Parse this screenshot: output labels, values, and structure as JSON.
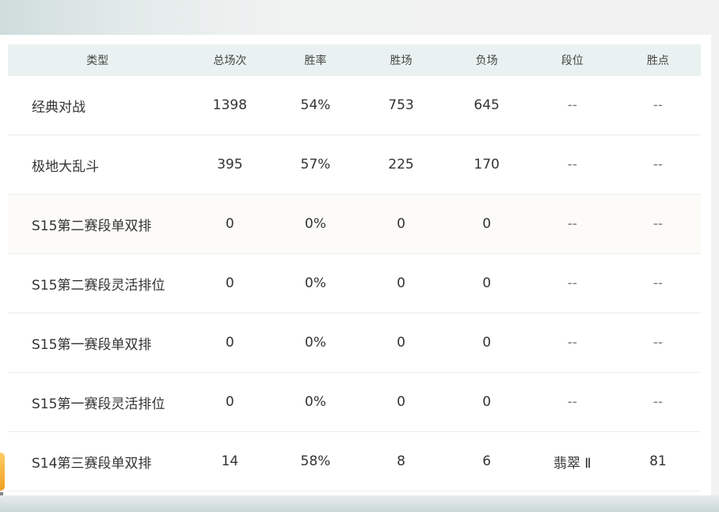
{
  "table": {
    "headers": {
      "type": "类型",
      "total": "总场次",
      "winrate": "胜率",
      "wins": "胜场",
      "losses": "负场",
      "rank": "段位",
      "lp": "胜点"
    },
    "rows": [
      {
        "type": "经典对战",
        "total": "1398",
        "winrate": "54%",
        "wins": "753",
        "losses": "645",
        "rank": "--",
        "lp": "--"
      },
      {
        "type": "极地大乱斗",
        "total": "395",
        "winrate": "57%",
        "wins": "225",
        "losses": "170",
        "rank": "--",
        "lp": "--"
      },
      {
        "type": "S15第二赛段单双排",
        "total": "0",
        "winrate": "0%",
        "wins": "0",
        "losses": "0",
        "rank": "--",
        "lp": "--"
      },
      {
        "type": "S15第二赛段灵活排位",
        "total": "0",
        "winrate": "0%",
        "wins": "0",
        "losses": "0",
        "rank": "--",
        "lp": "--"
      },
      {
        "type": "S15第一赛段单双排",
        "total": "0",
        "winrate": "0%",
        "wins": "0",
        "losses": "0",
        "rank": "--",
        "lp": "--"
      },
      {
        "type": "S15第一赛段灵活排位",
        "total": "0",
        "winrate": "0%",
        "wins": "0",
        "losses": "0",
        "rank": "--",
        "lp": "--"
      },
      {
        "type": "S14第三赛段单双排",
        "total": "14",
        "winrate": "58%",
        "wins": "8",
        "losses": "6",
        "rank": "翡翠 Ⅱ",
        "lp": "81"
      }
    ]
  },
  "colors": {
    "header_bg": "#e9f2f0",
    "text": "#333333",
    "accent_widget": "#f0a020"
  }
}
